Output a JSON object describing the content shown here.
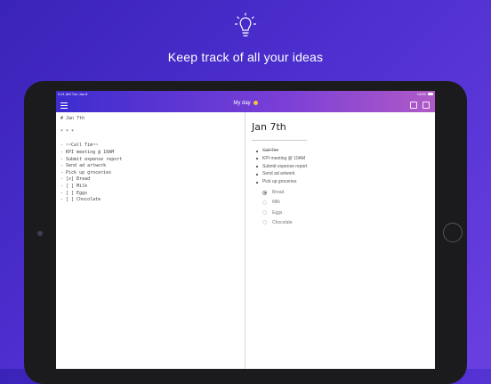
{
  "headline": "Keep track of all your ideas",
  "status": {
    "time": "9:41 AM   Tue Jan 8",
    "signal": "100%"
  },
  "navbar": {
    "title": "My day"
  },
  "editor": {
    "lines": [
      "# Jan 7th",
      "",
      "* * *",
      "",
      "- ~~Call Tim~~",
      "- KPI meeting @ 10AM",
      "- Submit expense report",
      "- Send ad artwork",
      "- Pick up groceries",
      "- [x] Bread",
      "- [ ] Milk",
      "- [ ] Eggs",
      "- [ ] Chocolate"
    ]
  },
  "preview": {
    "title": "Jan 7th",
    "items": [
      {
        "text": "Call Tim",
        "done": true
      },
      {
        "text": "KPI meeting @ 10AM",
        "done": false
      },
      {
        "text": "Submit expense report",
        "done": false
      },
      {
        "text": "Send ad artwork",
        "done": false
      },
      {
        "text": "Pick up groceries",
        "done": false
      }
    ],
    "checklist": [
      {
        "text": "Bread",
        "checked": true
      },
      {
        "text": "Milk",
        "checked": false
      },
      {
        "text": "Eggs",
        "checked": false
      },
      {
        "text": "Chocolate",
        "checked": false
      }
    ]
  },
  "icons": [
    "lightbulb-icon",
    "menu-icon",
    "sun-icon",
    "calendar-icon",
    "expand-icon"
  ]
}
